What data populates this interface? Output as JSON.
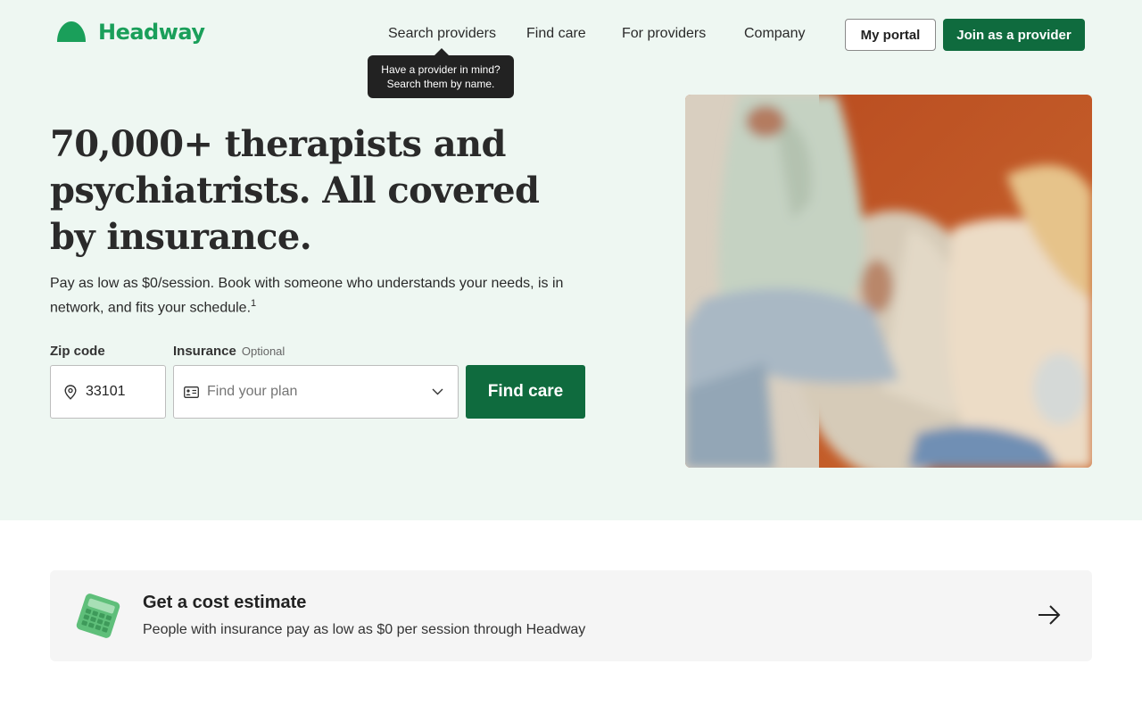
{
  "brand": {
    "name": "Headway",
    "color": "#1a9f5a"
  },
  "nav": {
    "search_providers": "Search providers",
    "find_care": "Find care",
    "for_providers": "For providers",
    "company": "Company"
  },
  "tooltip": {
    "line1": "Have a provider in mind?",
    "line2": "Search them by name."
  },
  "header_buttons": {
    "portal": "My portal",
    "join": "Join as a provider"
  },
  "hero": {
    "headline": "70,000+ therapists and psychiatrists. All covered by insurance.",
    "subtext": "Pay as low as $0/session. Book with someone who understands your needs, is in network, and fits your schedule.",
    "footnote": "1"
  },
  "search": {
    "zip_label": "Zip code",
    "zip_value": "33101",
    "insurance_label": "Insurance",
    "insurance_optional": "Optional",
    "insurance_placeholder": "Find your plan",
    "submit": "Find care"
  },
  "cost_card": {
    "title": "Get a cost estimate",
    "description": "People with insurance pay as low as $0 per session through Headway"
  },
  "icons": [
    "logo-icon",
    "location-pin-icon",
    "id-card-icon",
    "chevron-down-icon",
    "calculator-icon",
    "arrow-right-icon"
  ],
  "colors": {
    "hero_bg": "#eef7f2",
    "primary_button": "#0f6b3e",
    "card_bg": "#f5f5f5"
  }
}
